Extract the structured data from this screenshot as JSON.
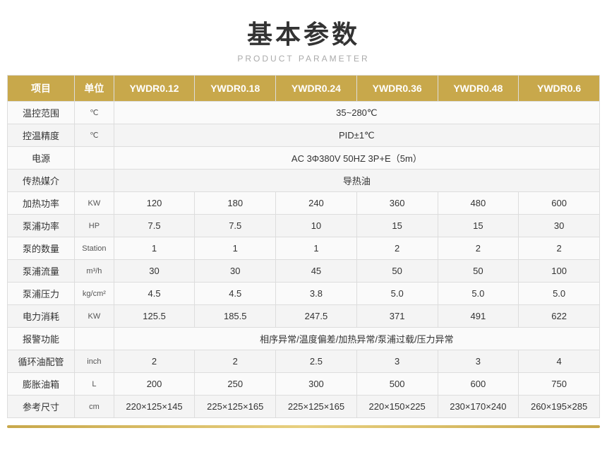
{
  "title": "基本参数",
  "subtitle": "PRODUCT PARAMETER",
  "table": {
    "headers": [
      "项目",
      "单位",
      "YWDR0.12",
      "YWDR0.18",
      "YWDR0.24",
      "YWDR0.36",
      "YWDR0.48",
      "YWDR0.6"
    ],
    "rows": [
      {
        "item": "温控范围",
        "unit": "℃",
        "span": true,
        "spanValue": "35~280℃"
      },
      {
        "item": "控温精度",
        "unit": "℃",
        "span": true,
        "spanValue": "PID±1℃"
      },
      {
        "item": "电源",
        "unit": "",
        "span": true,
        "spanValue": "AC 3Φ380V 50HZ 3P+E（5m）"
      },
      {
        "item": "传热媒介",
        "unit": "",
        "span": true,
        "spanValue": "导热油"
      },
      {
        "item": "加热功率",
        "unit": "KW",
        "span": false,
        "values": [
          "120",
          "180",
          "240",
          "360",
          "480",
          "600"
        ]
      },
      {
        "item": "泵浦功率",
        "unit": "HP",
        "span": false,
        "values": [
          "7.5",
          "7.5",
          "10",
          "15",
          "15",
          "30"
        ]
      },
      {
        "item": "泵的数量",
        "unit": "Station",
        "span": false,
        "values": [
          "1",
          "1",
          "1",
          "2",
          "2",
          "2"
        ]
      },
      {
        "item": "泵浦流量",
        "unit": "m³/h",
        "span": false,
        "values": [
          "30",
          "30",
          "45",
          "50",
          "50",
          "100"
        ]
      },
      {
        "item": "泵浦压力",
        "unit": "kg/cm²",
        "span": false,
        "values": [
          "4.5",
          "4.5",
          "3.8",
          "5.0",
          "5.0",
          "5.0"
        ]
      },
      {
        "item": "电力消耗",
        "unit": "KW",
        "span": false,
        "values": [
          "125.5",
          "185.5",
          "247.5",
          "371",
          "491",
          "622"
        ]
      },
      {
        "item": "报警功能",
        "unit": "",
        "span": true,
        "spanValue": "相序异常/温度偏差/加热异常/泵浦过载/压力异常"
      },
      {
        "item": "循环油配管",
        "unit": "inch",
        "span": false,
        "values": [
          "2",
          "2",
          "2.5",
          "3",
          "3",
          "4"
        ]
      },
      {
        "item": "膨胀油箱",
        "unit": "L",
        "span": false,
        "values": [
          "200",
          "250",
          "300",
          "500",
          "600",
          "750"
        ]
      },
      {
        "item": "参考尺寸",
        "unit": "cm",
        "span": false,
        "values": [
          "220×125×145",
          "225×125×165",
          "225×125×165",
          "220×150×225",
          "230×170×240",
          "260×195×285"
        ]
      }
    ]
  }
}
